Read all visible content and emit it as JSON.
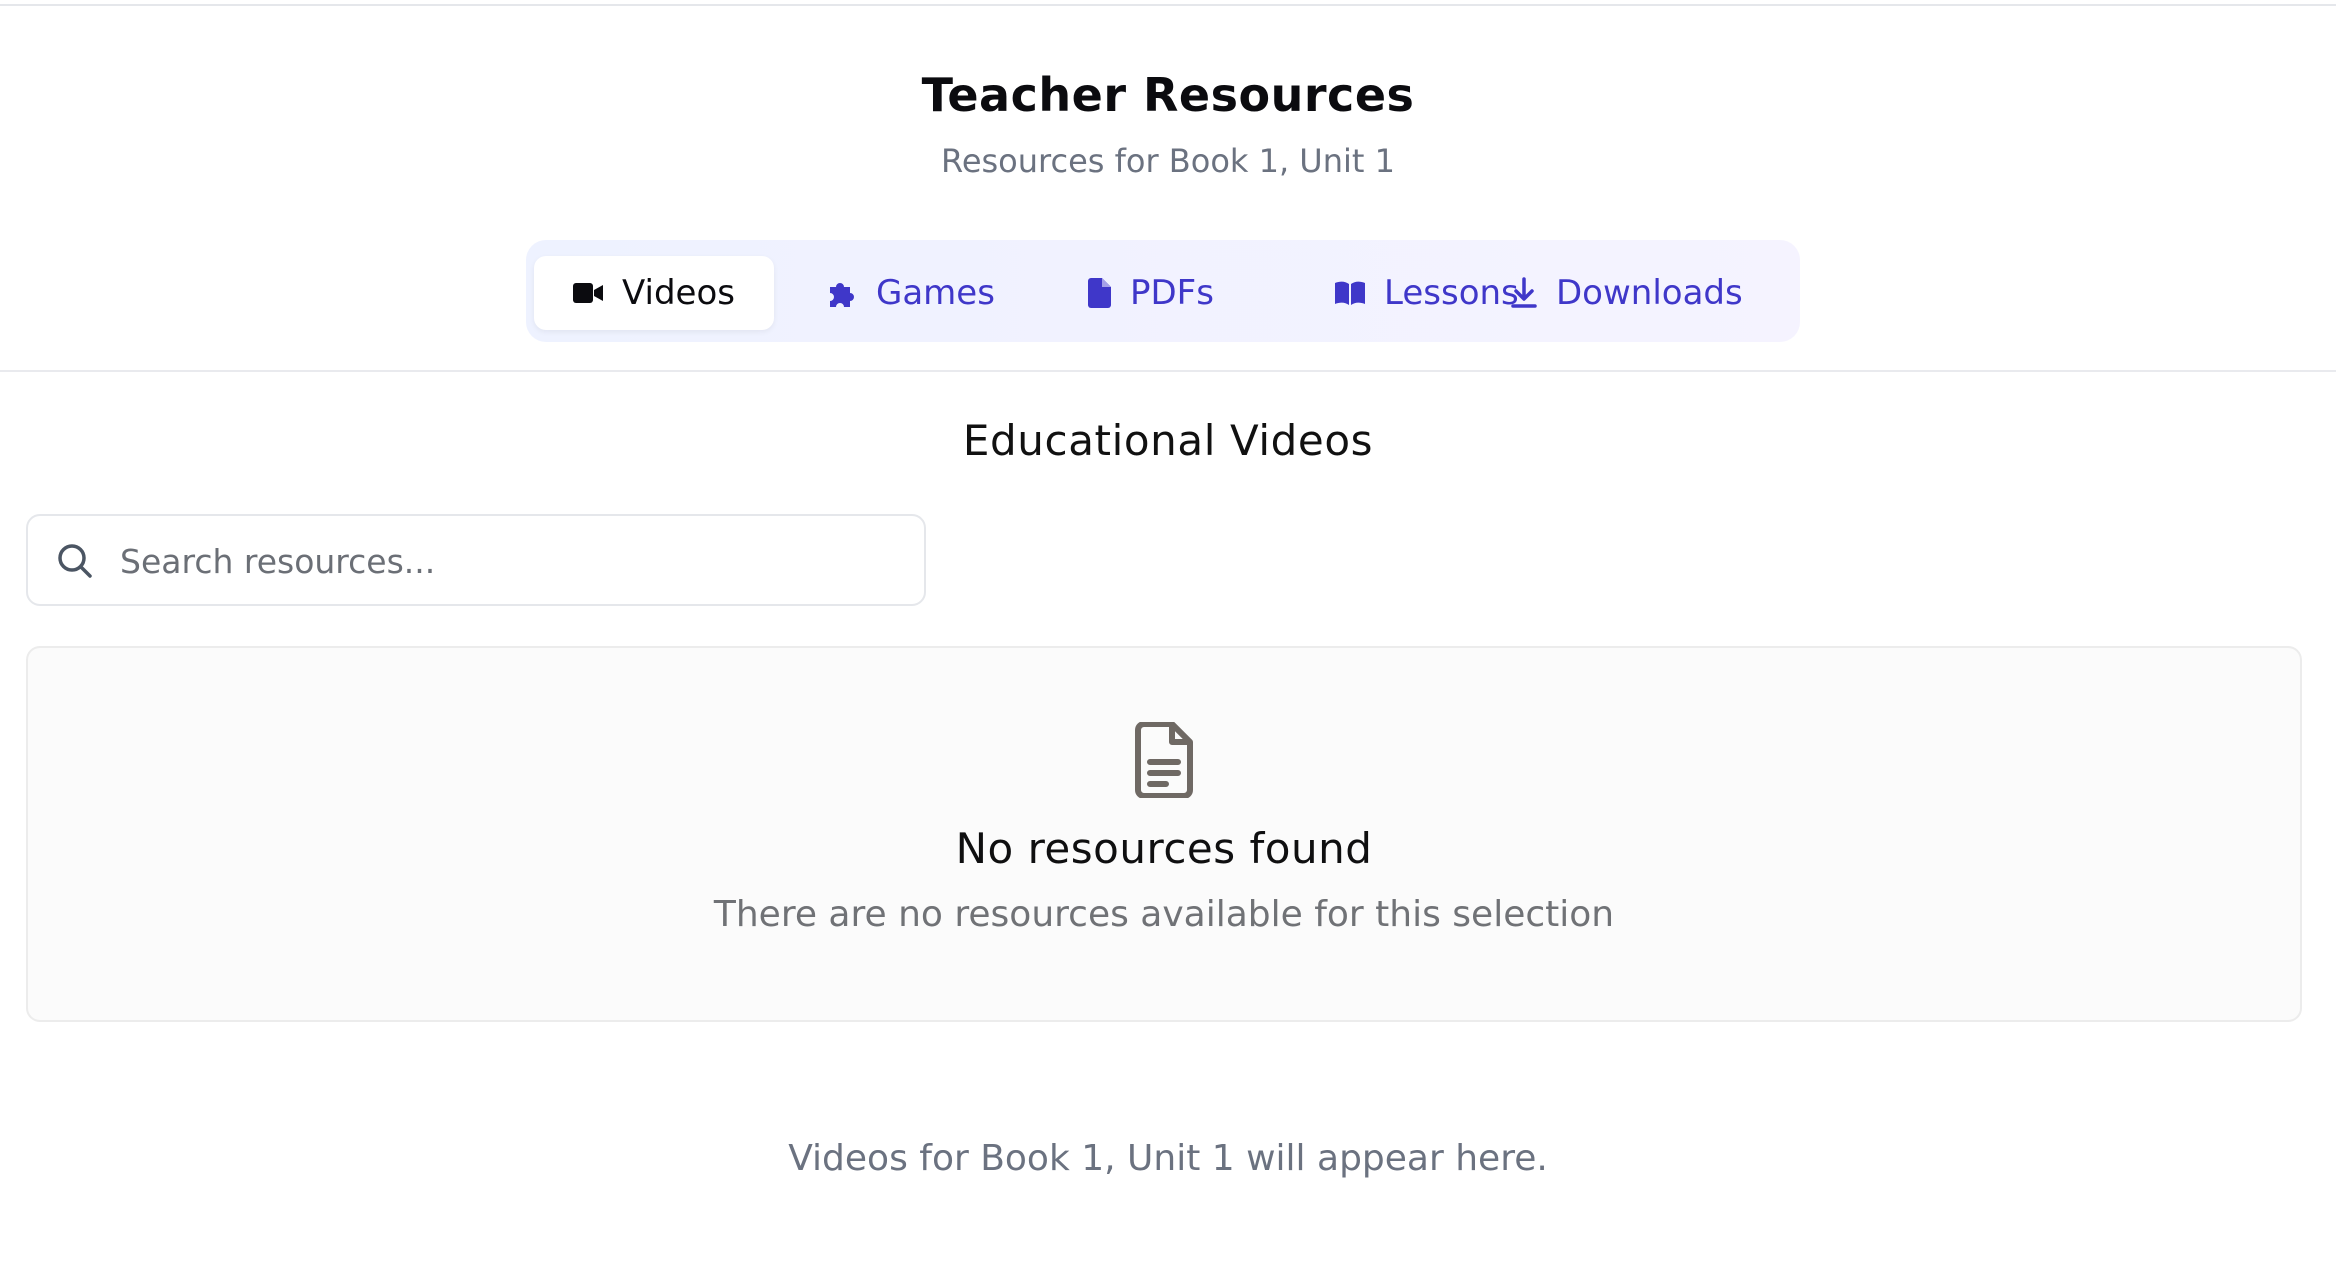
{
  "header": {
    "title": "Teacher Resources",
    "subtitle": "Resources for Book 1, Unit 1"
  },
  "tabs": [
    {
      "label": "Videos",
      "icon": "video-camera-icon",
      "active": true
    },
    {
      "label": "Games",
      "icon": "puzzle-icon",
      "active": false
    },
    {
      "label": "PDFs",
      "icon": "file-icon",
      "active": false
    },
    {
      "label": "Lessons",
      "icon": "book-open-icon",
      "active": false
    },
    {
      "label": "Downloads",
      "icon": "download-icon",
      "active": false
    }
  ],
  "section": {
    "title": "Educational Videos"
  },
  "search": {
    "placeholder": "Search resources...",
    "value": ""
  },
  "empty_state": {
    "icon": "file-text-icon",
    "title": "No resources found",
    "description": "There are no resources available for this selection"
  },
  "footer": {
    "note": "Videos for Book 1, Unit 1 will appear here."
  },
  "colors": {
    "accent": "#3f37c9",
    "active_tab_text": "#0b0b0f",
    "muted_text": "#6b7280"
  }
}
